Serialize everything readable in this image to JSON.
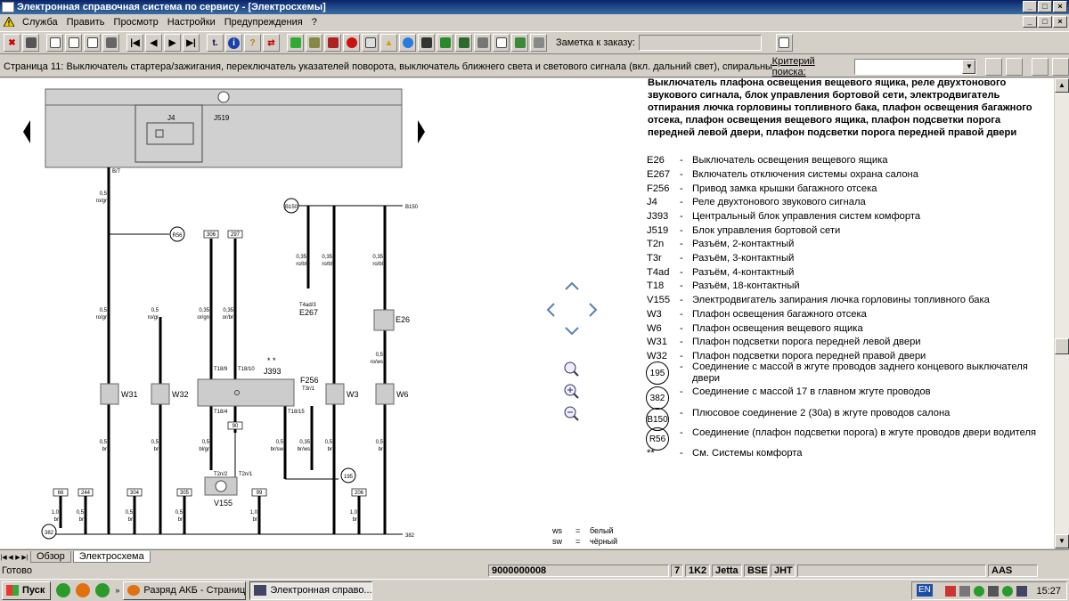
{
  "window": {
    "title": "Электронная справочная система по сервису - [Электросхемы]"
  },
  "menu": {
    "items": [
      "Служба",
      "Править",
      "Просмотр",
      "Настройки",
      "Предупреждения",
      "?"
    ]
  },
  "toolbar": {
    "order_label": "Заметка к заказу:",
    "order_value": "",
    "buttons": [
      "close-icon",
      "print-icon",
      "new-doc-icon",
      "edit-icon",
      "copy-icon",
      "car-icon",
      "first-page-icon",
      "prev-page-icon",
      "next-page-icon",
      "last-page-icon",
      "t-icon",
      "info-icon",
      "help-icon",
      "swap-icon",
      "tree-icon",
      "calc-icon",
      "book-icon",
      "stop-icon",
      "list-icon",
      "warning-icon",
      "globe-icon",
      "disk-icon",
      "wrench-icon",
      "vehicle-icon",
      "print-preview-icon",
      "check-icon",
      "tools-icon",
      "layers-icon"
    ]
  },
  "infobar": {
    "page_desc": "Страница 11: Выключатель стартера/зажигания, переключатель указателей поворота, выключатель ближнего света и светового сигнала (вкл. дальний свет), спиральный кабель",
    "criteria_label": "Критерий поиска:",
    "criteria_value": ""
  },
  "diagram": {
    "j519": "J519",
    "j4": "J4",
    "b7": "B/7",
    "w1_a": "0,5",
    "w1_b": "ro/gr",
    "r56": "R56",
    "b150": "B150",
    "b150r": "B150",
    "n306": "306",
    "n297": "297",
    "c035a": "0,35",
    "c035a_c": "ro/bl",
    "c035b": "0,35",
    "c035b_c": "ro/bl",
    "c035c": "0,35",
    "c035c_c": "ro/bl",
    "t4ad": "T4ad/3",
    "e267": "E267",
    "e26": "E26",
    "w_r1": "0,5",
    "w_r1c": "ro/gr",
    "w_r2": "0,5",
    "w_r2c": "ro/gr",
    "w_or1": "0,35",
    "w_or1c": "or/gn",
    "w_or2": "0,35",
    "w_or2c": "or/br",
    "w_e26": "0,5",
    "w_e26c": "ro/ws",
    "t18_9": "T18/9",
    "t18_10": "T18/10",
    "j393": "J393",
    "stars": "* *",
    "f256": "F256",
    "t3r1": "T3r/1",
    "w31": "W31",
    "w32": "W32",
    "w3": "W3",
    "w6": "W6",
    "t18_4": "T18/4",
    "t18_15": "T18/15",
    "n90": "90",
    "n99": "99",
    "t2n2": "T2n/2",
    "t2n1": "T2n/1",
    "v155": "V155",
    "g195": "195",
    "n66": "66",
    "n244": "244",
    "n304": "304",
    "n305": "305",
    "n206": "206",
    "g382": "382",
    "g382r": "382",
    "br05": "0,5",
    "br10": "1,0",
    "brc": "br",
    "brsw": "br/sw",
    "brws": "br/ws",
    "bl": "bl/gr"
  },
  "colors_legend": [
    {
      "code": "ws",
      "eq": "=",
      "name": "белый"
    },
    {
      "code": "sw",
      "eq": "=",
      "name": "чёрный"
    }
  ],
  "legend": {
    "heading": "Выключатель плафона освещения вещевого ящика, реле двухтонового звукового сигнала, блок управления бортовой сети, электродвигатель отпирания лючка горловины топливного бака, плафон освещения багажного отсека, плафон освещения вещевого ящика, плафон подсветки порога передней левой двери, плафон подсветки порога передней правой двери",
    "items": [
      {
        "code": "E26",
        "desc": "Выключатель освещения вещевого ящика"
      },
      {
        "code": "E267",
        "desc": "Включатель отключения системы охрана салона"
      },
      {
        "code": "F256",
        "desc": "Привод замка крышки багажного отсека"
      },
      {
        "code": "J4",
        "desc": "Реле двухтонового звукового сигнала"
      },
      {
        "code": "J393",
        "desc": "Центральный блок управления систем комфорта"
      },
      {
        "code": "J519",
        "desc": "Блок управления бортовой сети"
      },
      {
        "code": "T2n",
        "desc": "Разъём, 2-контактный"
      },
      {
        "code": "T3r",
        "desc": "Разъём, 3-контактный"
      },
      {
        "code": "T4ad",
        "desc": "Разъём, 4-контактный"
      },
      {
        "code": "T18",
        "desc": "Разъём, 18-контактный"
      },
      {
        "code": "V155",
        "desc": "Электродвигатель запирания лючка горловины топливного бака"
      },
      {
        "code": "W3",
        "desc": "Плафон освещения багажного отсека"
      },
      {
        "code": "W6",
        "desc": "Плафон освещения вещевого ящика"
      },
      {
        "code": "W31",
        "desc": "Плафон подсветки порога передней левой двери"
      },
      {
        "code": "W32",
        "desc": "Плафон подсветки порога передней правой двери"
      }
    ],
    "circles": [
      {
        "code": "195",
        "desc": "Соединение с массой в жгуте проводов заднего концевого выключателя двери"
      },
      {
        "code": "382",
        "desc": "Соединение с массой 17 в главном жгуте проводов"
      },
      {
        "code": "B150",
        "desc": "Плюсовое соединение 2 (30а) в жгуте проводов салона"
      },
      {
        "code": "R56",
        "desc": "Соединение (плафон подсветки порога) в жгуте проводов двери водителя"
      }
    ],
    "footnote": {
      "code": "**",
      "desc": "См. Системы комфорта"
    }
  },
  "tabs": [
    "Обзор",
    "Электросхема"
  ],
  "status": {
    "ready": "Готово",
    "vin": "9000000008",
    "f1": "7",
    "f2": "1K2",
    "f3": "Jetta",
    "f4": "BSE",
    "f5": "JHT",
    "f6": "AAS"
  },
  "taskbar": {
    "start": "Пуск",
    "tasks": [
      "Разряд АКБ - Страница...",
      "Электронная справо..."
    ],
    "lang": "EN",
    "clock": "15:27"
  }
}
